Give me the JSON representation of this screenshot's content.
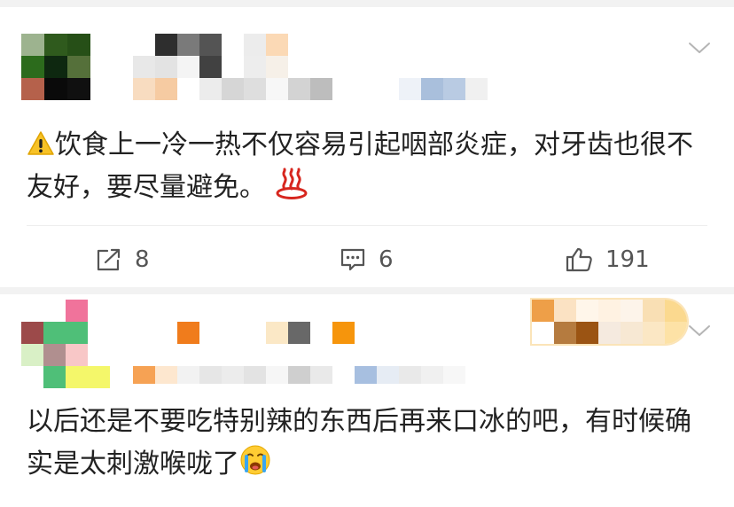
{
  "comments": [
    {
      "text": "饮食上一冷一热不仅容易引起咽部炎症，对牙齿也很不友好，要尽量避免。",
      "warning_icon": "warning-sign-icon",
      "trailing_emoji": "hot-springs-emoji",
      "actions": {
        "repost": {
          "icon": "share-arrow-icon",
          "count": "8"
        },
        "comment": {
          "icon": "comment-bubble-icon",
          "count": "6"
        },
        "like": {
          "icon": "thumbs-up-icon",
          "count": "191"
        }
      },
      "menu_icon": "chevron-down-icon"
    },
    {
      "text": "以后还是不要吃特别辣的东西后再来口冰的吧，有时候确实是太刺激喉咙了",
      "trailing_emoji": "crying-face-emoji",
      "menu_icon": "chevron-down-icon"
    }
  ],
  "colors": {
    "background": "#f2f2f2",
    "card": "#ffffff",
    "text": "#222222",
    "action_text": "#555555",
    "chevron": "#b5b5b5"
  }
}
